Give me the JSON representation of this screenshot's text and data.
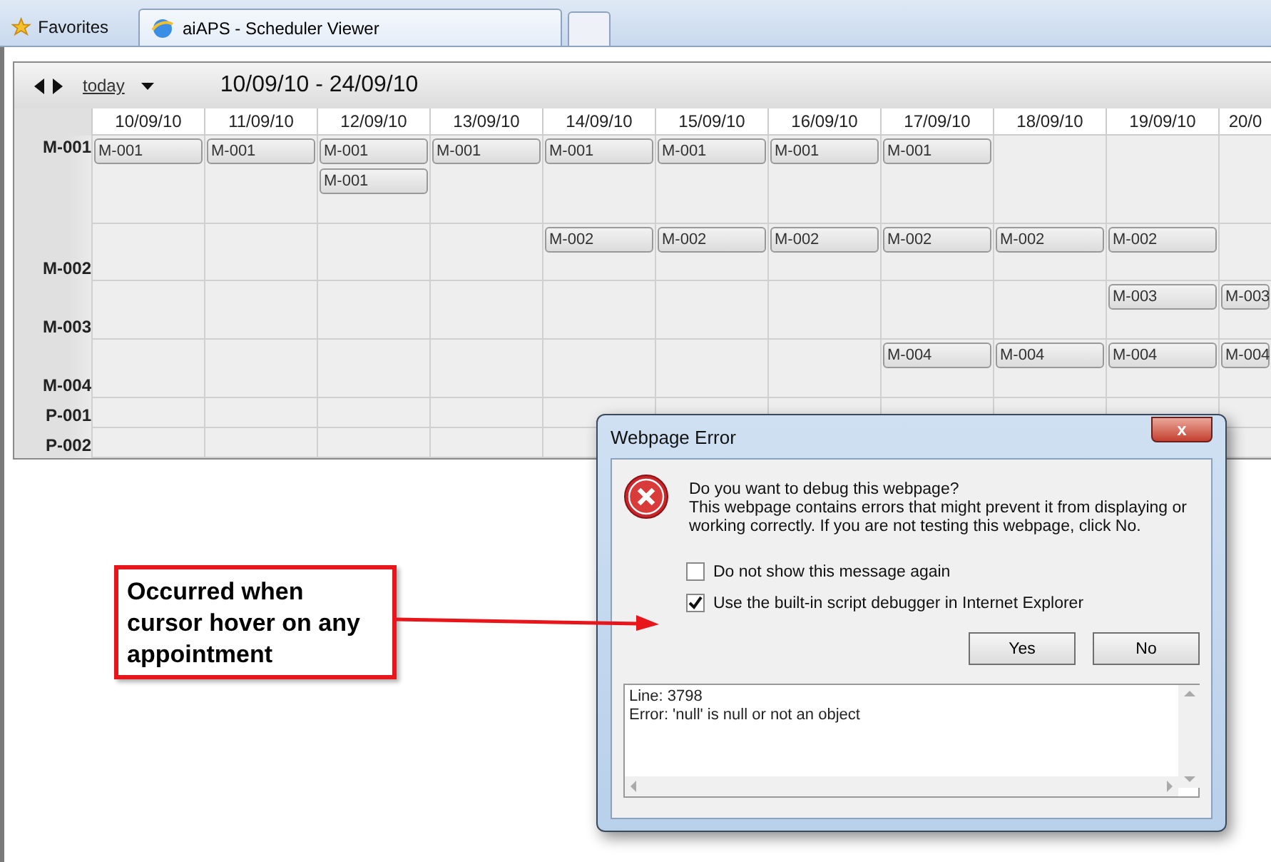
{
  "browser": {
    "favorites": "Favorites",
    "tabs": [
      {
        "label": "aiAPS - Scheduler Viewer",
        "selected": true
      }
    ]
  },
  "scheduler": {
    "today": "today",
    "range": "10/09/10 - 24/09/10",
    "days": [
      "10/09/10",
      "11/09/10",
      "12/09/10",
      "13/09/10",
      "14/09/10",
      "15/09/10",
      "16/09/10",
      "17/09/10",
      "18/09/10",
      "19/09/10",
      "20/0"
    ],
    "rows": [
      {
        "resource": "M-001",
        "cells": [
          [
            "M-001"
          ],
          [
            "M-001"
          ],
          [
            "M-001",
            "M-001"
          ],
          [
            "M-001"
          ],
          [
            "M-001"
          ],
          [
            "M-001"
          ],
          [
            "M-001"
          ],
          [
            "M-001"
          ],
          [],
          [],
          []
        ]
      },
      {
        "resource": "M-002",
        "cells": [
          [],
          [],
          [],
          [],
          [
            "M-002"
          ],
          [
            "M-002"
          ],
          [
            "M-002"
          ],
          [
            "M-002"
          ],
          [
            "M-002"
          ],
          [
            "M-002"
          ],
          []
        ]
      },
      {
        "resource": "M-003",
        "cells": [
          [],
          [],
          [],
          [],
          [],
          [],
          [],
          [],
          [],
          [
            "M-003"
          ],
          [
            "M-003"
          ]
        ]
      },
      {
        "resource": "M-004",
        "cells": [
          [],
          [],
          [],
          [],
          [],
          [],
          [],
          [
            "M-004"
          ],
          [
            "M-004"
          ],
          [
            "M-004"
          ],
          [
            "M-004"
          ]
        ]
      },
      {
        "resource": "P-001",
        "cells": [
          [],
          [],
          [],
          [],
          [],
          [],
          [],
          [],
          [],
          [],
          []
        ]
      },
      {
        "resource": "P-002",
        "cells": [
          [],
          [],
          [],
          [],
          [],
          [],
          [],
          [],
          [],
          [],
          []
        ]
      }
    ]
  },
  "dialog": {
    "title": "Webpage Error",
    "close": "x",
    "heading": "Do you want to debug this webpage?",
    "message": "This webpage contains errors that might prevent it from displaying or working correctly. If you are not testing this webpage, click No.",
    "options": [
      {
        "label": "Do not show this message again",
        "checked": false
      },
      {
        "label": "Use the built-in script debugger in Internet Explorer",
        "checked": true
      }
    ],
    "buttons": [
      "Yes",
      "No"
    ],
    "details": [
      "Line: 3798",
      "Error: 'null' is null or not an object"
    ]
  },
  "callout": {
    "text": "Occurred when cursor hover on any appointment"
  }
}
